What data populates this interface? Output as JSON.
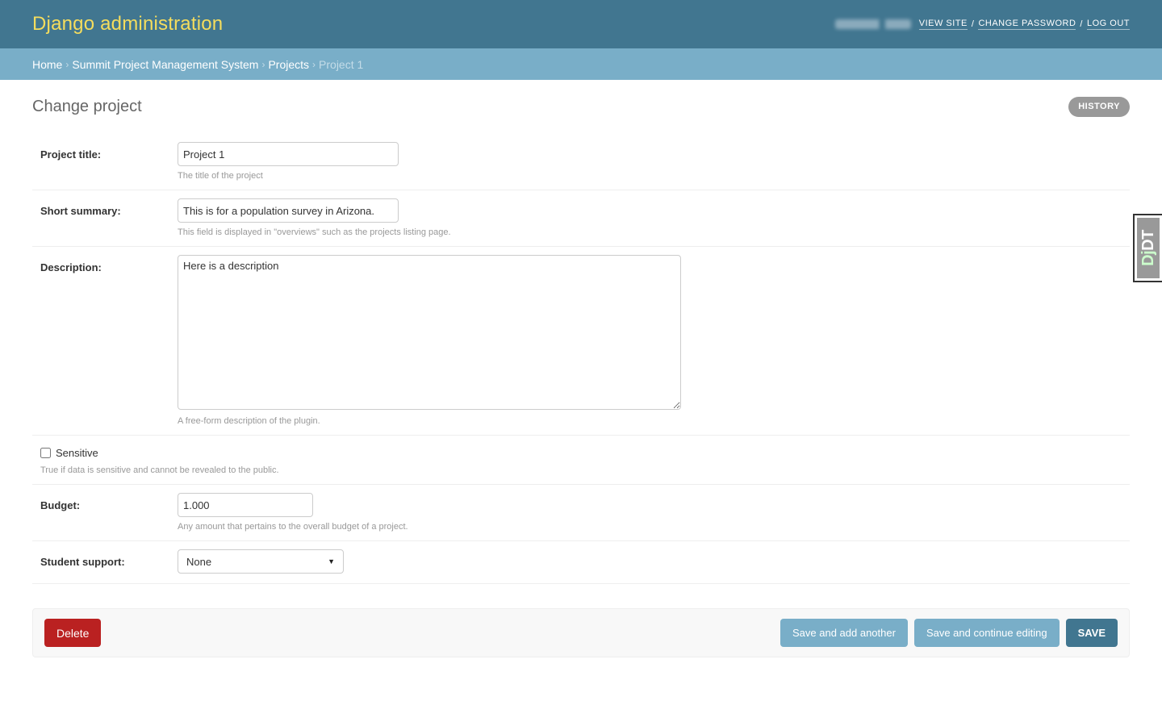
{
  "header": {
    "branding": "Django administration",
    "user_name_blurred": "",
    "user_tools": [
      {
        "label": "View site"
      },
      {
        "label": "Change password"
      },
      {
        "label": "Log out"
      }
    ],
    "separator": "/"
  },
  "breadcrumbs": {
    "items": [
      {
        "label": "Home"
      },
      {
        "label": "Summit Project Management System"
      },
      {
        "label": "Projects"
      }
    ],
    "current": "Project 1",
    "separator": "›"
  },
  "page": {
    "title": "Change project",
    "history_label": "History"
  },
  "form": {
    "project_title": {
      "label": "Project title:",
      "value": "Project 1",
      "help": "The title of the project"
    },
    "short_summary": {
      "label": "Short summary:",
      "value": "This is for a population survey in Arizona.",
      "help": "This field is displayed in \"overviews\" such as the projects listing page."
    },
    "description": {
      "label": "Description:",
      "value": "Here is a description",
      "help": "A free-form description of the plugin."
    },
    "sensitive": {
      "label": "Sensitive",
      "checked": false,
      "help": "True if data is sensitive and cannot be revealed to the public."
    },
    "budget": {
      "label": "Budget:",
      "value": "1.000",
      "help": "Any amount that pertains to the overall budget of a project."
    },
    "student_support": {
      "label": "Student support:",
      "selected": "None"
    }
  },
  "submit_row": {
    "delete_label": "Delete",
    "save_add_another_label": "Save and add another",
    "save_continue_label": "Save and continue editing",
    "save_label": "Save"
  },
  "debug_toolbar": {
    "handle_prefix": "Dj",
    "handle_suffix": "DT"
  },
  "colors": {
    "header_bg": "#417690",
    "branding": "#f5dd5d",
    "breadcrumbs_bg": "#79aec8",
    "delete": "#ba2121",
    "secondary_button": "#79aec8",
    "primary_button": "#417690"
  }
}
